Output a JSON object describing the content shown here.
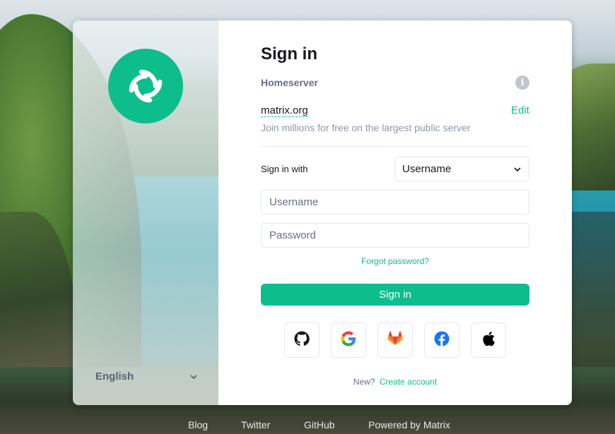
{
  "brand": {
    "accent": "#0dbd8b",
    "text_dark": "#17191c",
    "text_muted": "#61708b"
  },
  "logo": {
    "icon": "element-logo-icon"
  },
  "language": {
    "label": "English",
    "icon": "chevron-down-icon"
  },
  "form": {
    "title": "Sign in",
    "homeserver_label": "Homeserver",
    "info_icon": "info-icon",
    "homeserver_name": "matrix.org",
    "edit_label": "Edit",
    "homeserver_desc": "Join millions for free on the largest public server",
    "sign_in_with_label": "Sign in with",
    "sign_in_with_value": "Username",
    "username_placeholder": "Username",
    "password_placeholder": "Password",
    "forgot_label": "Forgot password?",
    "submit_label": "Sign in",
    "sso_providers": [
      "github-icon",
      "google-icon",
      "gitlab-icon",
      "facebook-icon",
      "apple-icon"
    ],
    "new_label": "New?",
    "create_label": "Create account"
  },
  "footer": {
    "links": [
      "Blog",
      "Twitter",
      "GitHub",
      "Powered by Matrix"
    ]
  }
}
